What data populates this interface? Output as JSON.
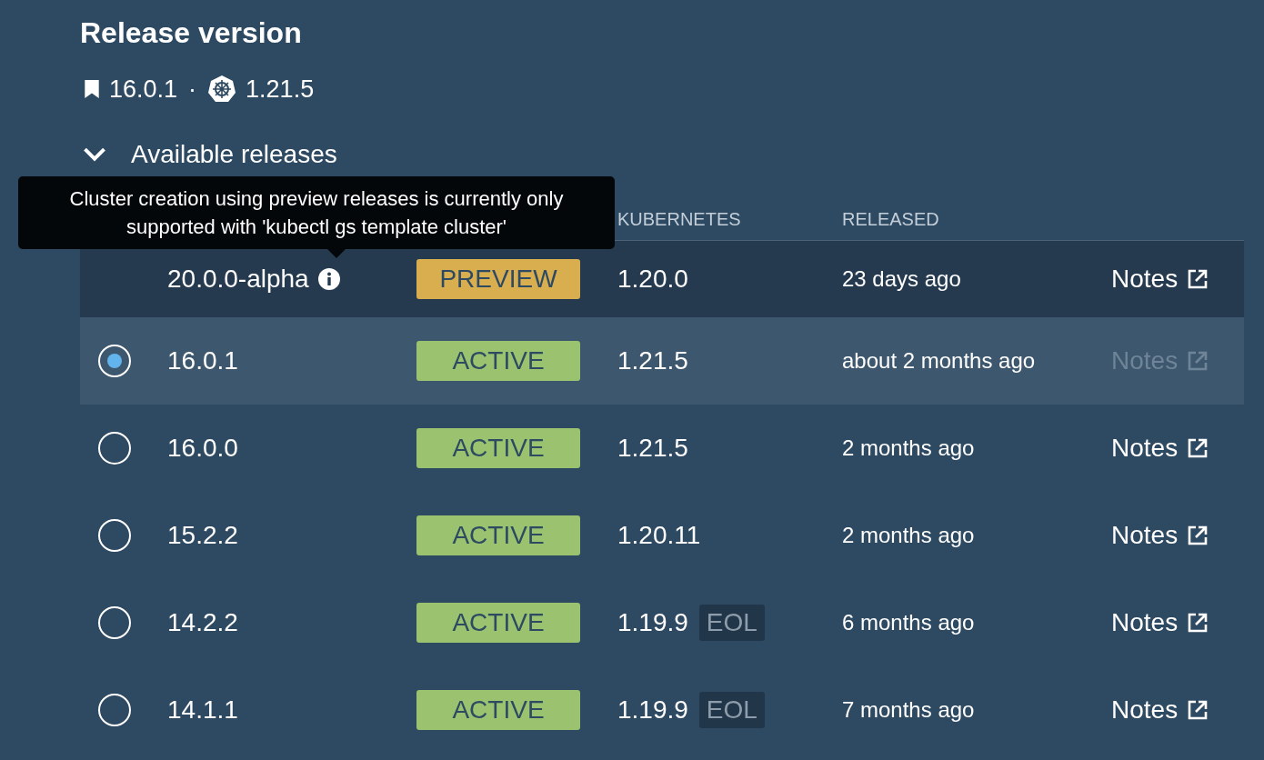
{
  "title": "Release version",
  "current": {
    "release": "16.0.1",
    "separator": "·",
    "kubernetes": "1.21.5"
  },
  "available": {
    "label": "Available releases",
    "expanded": true
  },
  "table": {
    "columns": [
      "KUBERNETES",
      "RELEASED"
    ],
    "rows": [
      {
        "kind": "preview",
        "selected": false,
        "version": "20.0.0-alpha",
        "status": "PREVIEW",
        "kubernetes": "1.20.0",
        "released": "23 days ago",
        "notes": "Notes",
        "notes_disabled": false
      },
      {
        "kind": "release",
        "selected": true,
        "version": "16.0.1",
        "status": "ACTIVE",
        "kubernetes": "1.21.5",
        "released": "about 2 months ago",
        "notes": "Notes",
        "notes_disabled": true
      },
      {
        "kind": "release",
        "selected": false,
        "version": "16.0.0",
        "status": "ACTIVE",
        "kubernetes": "1.21.5",
        "released": "2 months ago",
        "notes": "Notes",
        "notes_disabled": false
      },
      {
        "kind": "release",
        "selected": false,
        "version": "15.2.2",
        "status": "ACTIVE",
        "kubernetes": "1.20.11",
        "released": "2 months ago",
        "notes": "Notes",
        "notes_disabled": false
      },
      {
        "kind": "release",
        "selected": false,
        "version": "14.2.2",
        "status": "ACTIVE",
        "kubernetes": "1.19.9",
        "eol": "EOL",
        "released": "6 months ago",
        "notes": "Notes",
        "notes_disabled": false
      },
      {
        "kind": "release",
        "selected": false,
        "version": "14.1.1",
        "status": "ACTIVE",
        "kubernetes": "1.19.9",
        "eol": "EOL",
        "released": "7 months ago",
        "notes": "Notes",
        "notes_disabled": false
      }
    ]
  },
  "tooltip": "Cluster creation using preview releases is currently only supported with 'kubectl gs template cluster'"
}
